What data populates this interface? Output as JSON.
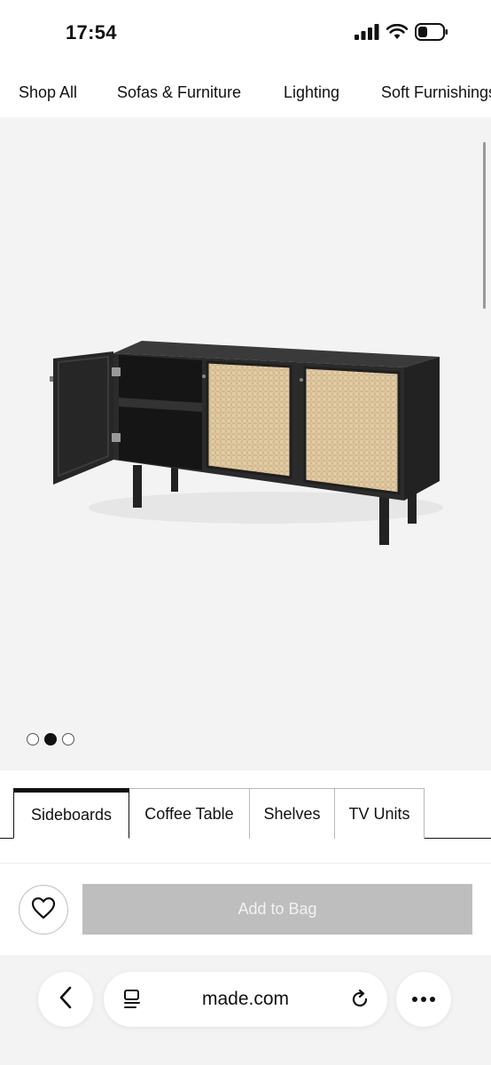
{
  "status": {
    "time": "17:54"
  },
  "nav": {
    "items": [
      "Shop All",
      "Sofas & Furniture",
      "Lighting",
      "Soft Furnishings"
    ]
  },
  "gallery": {
    "image_alt": "Black sideboard with rattan cane doors",
    "dot_count": 3,
    "active_index": 1
  },
  "tabs": [
    {
      "label": "Sideboards",
      "active": true
    },
    {
      "label": "Coffee Table",
      "active": false
    },
    {
      "label": "Shelves",
      "active": false
    },
    {
      "label": "TV Units",
      "active": false
    }
  ],
  "actions": {
    "add_to_bag": "Add to Bag"
  },
  "browser": {
    "url": "made.com"
  },
  "colors": {
    "button_disabled": "#bebebe",
    "gallery_bg": "#f3f3f3",
    "furniture": "#2b2b2b",
    "rattan": "#d9c29a"
  }
}
